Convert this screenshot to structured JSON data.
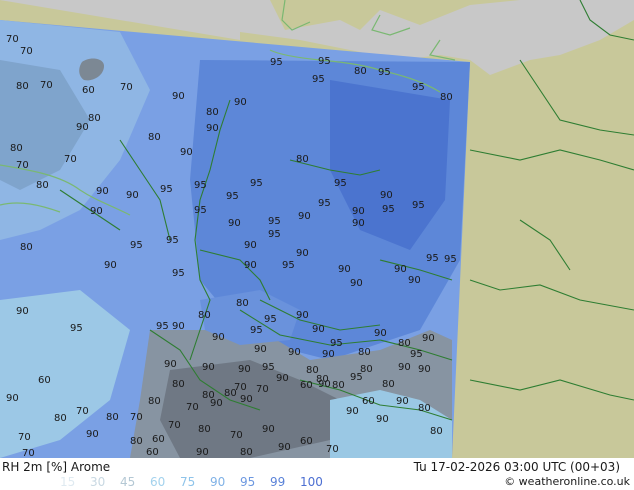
{
  "map": {
    "field_label": "RH 2m [%] Arome",
    "timestamp": "Tu 17-02-2026 03:00 UTC (00+03)",
    "copyright": "© weatheronline.co.uk",
    "colors": {
      "background_land": "#c8c89a",
      "background_sea": "#c8c8c8",
      "coast": "#7ab872",
      "border": "#2e7d32",
      "rh_90": "#6d96e2",
      "rh_95": "#5580d6",
      "rh_99": "#3e6acb",
      "rh_80": "#89aee3",
      "rh_75": "#9cc4e4",
      "rh_70": "#a4d0e8",
      "rh_60": "#7c8894",
      "rh_50": "#646c76"
    },
    "legend": [
      {
        "value": "15",
        "color": "#dfeaf1"
      },
      {
        "value": "30",
        "color": "#c8d8e2"
      },
      {
        "value": "45",
        "color": "#b4c8d4"
      },
      {
        "value": "60",
        "color": "#a3d2ed"
      },
      {
        "value": "75",
        "color": "#8fc4ea"
      },
      {
        "value": "90",
        "color": "#80b2e6"
      },
      {
        "value": "95",
        "color": "#6d98e0"
      },
      {
        "value": "99",
        "color": "#5a82d8"
      },
      {
        "value": "100",
        "color": "#4c6fd2"
      }
    ],
    "contour_labels": [
      "70",
      "70",
      "80",
      "70",
      "60",
      "70",
      "80",
      "90",
      "80",
      "80",
      "70",
      "90",
      "80",
      "90",
      "90",
      "90",
      "95",
      "95",
      "95",
      "80",
      "95",
      "95",
      "80",
      "70",
      "80",
      "90",
      "90",
      "95",
      "95",
      "95",
      "95",
      "80",
      "95",
      "90",
      "95",
      "95",
      "90",
      "95",
      "90",
      "95",
      "90",
      "95",
      "90",
      "90",
      "95",
      "95",
      "90",
      "95",
      "90",
      "80",
      "90",
      "95",
      "90",
      "95",
      "90",
      "90",
      "95",
      "95",
      "90",
      "90",
      "90",
      "95",
      "95",
      "90",
      "80",
      "80",
      "95",
      "90",
      "90",
      "95",
      "90",
      "95",
      "90",
      "80",
      "90",
      "95",
      "90",
      "90",
      "90",
      "80",
      "90",
      "90",
      "95",
      "90",
      "80",
      "90",
      "95",
      "80",
      "90",
      "70",
      "80",
      "80",
      "80",
      "70",
      "60",
      "80",
      "80",
      "90",
      "90",
      "90",
      "60",
      "70",
      "80",
      "70",
      "80",
      "70",
      "90",
      "90",
      "80",
      "60",
      "90",
      "80",
      "70",
      "80",
      "90",
      "80",
      "60",
      "70",
      "80",
      "70",
      "90",
      "60",
      "90",
      "90",
      "80",
      "70",
      "60",
      "90",
      "80",
      "90",
      "70"
    ]
  }
}
